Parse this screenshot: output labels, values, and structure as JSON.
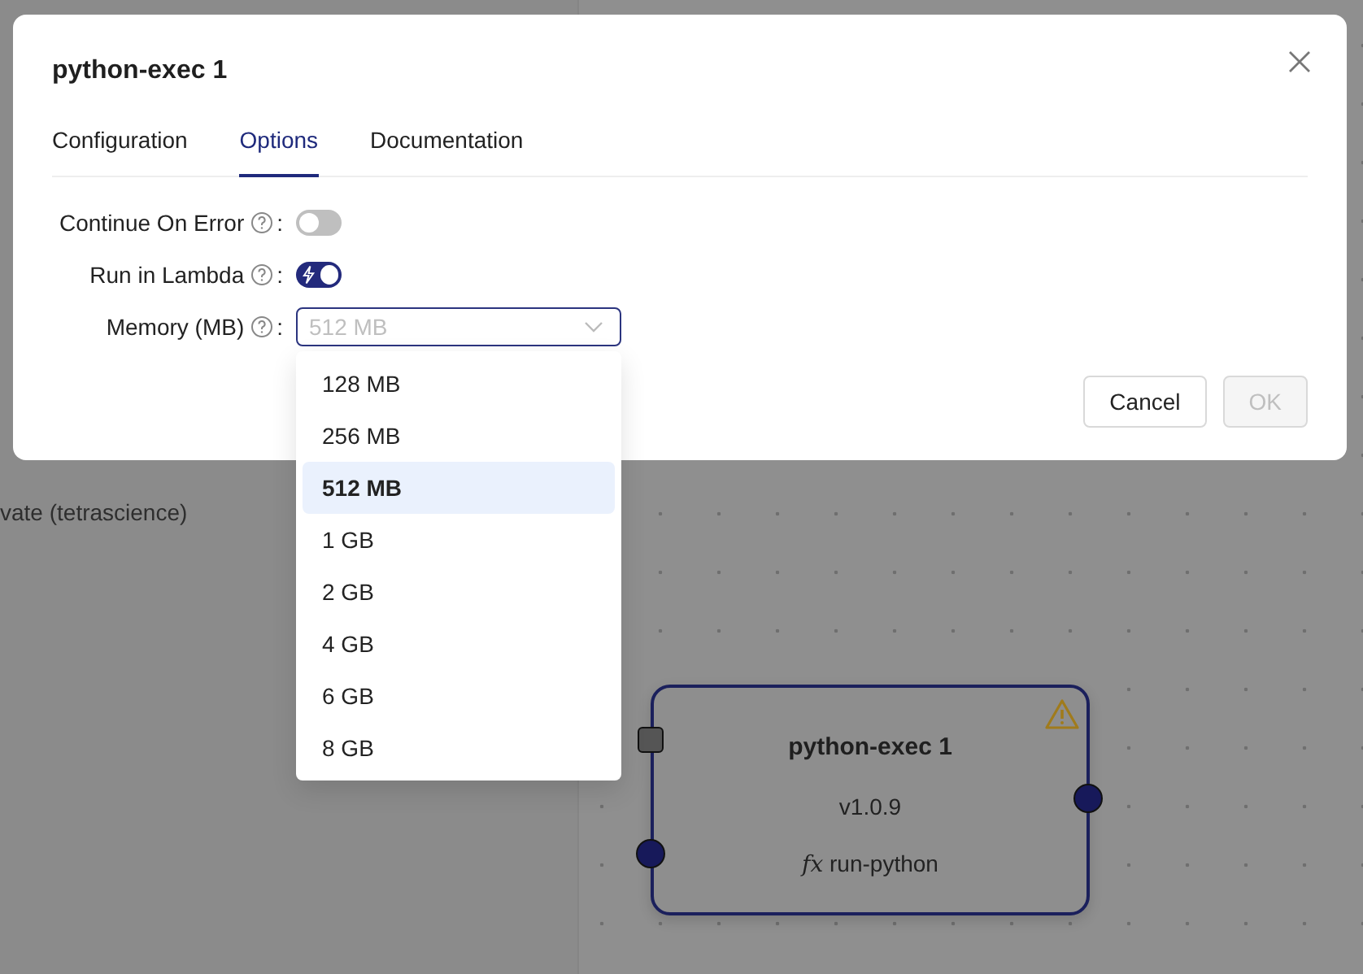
{
  "background_panel": {
    "fragments": [
      {
        "text": "vate (tetrascience)"
      }
    ]
  },
  "node": {
    "title": "python-exec 1",
    "version": "v1.0.9",
    "function_prefix": "fx",
    "function": "run-python",
    "warning": true
  },
  "modal": {
    "title": "python-exec 1",
    "tabs": [
      {
        "label": "Configuration",
        "selected": false
      },
      {
        "label": "Options",
        "selected": true
      },
      {
        "label": "Documentation",
        "selected": false
      }
    ],
    "fields": [
      {
        "kind": "switch",
        "label": "Continue On Error",
        "colon": ":",
        "on": false
      },
      {
        "kind": "switch",
        "label": "Run in Lambda",
        "colon": ":",
        "on": true
      },
      {
        "kind": "select",
        "label": "Memory (MB)",
        "colon": ":",
        "value": "512 MB",
        "expanded": true
      }
    ],
    "buttons": [
      {
        "label": "Cancel",
        "disabled": false
      },
      {
        "label": "OK",
        "disabled": true
      }
    ]
  },
  "dropdown": {
    "options": [
      {
        "label": "128 MB",
        "selected": false
      },
      {
        "label": "256 MB",
        "selected": false
      },
      {
        "label": "512 MB",
        "selected": true
      },
      {
        "label": "1 GB",
        "selected": false
      },
      {
        "label": "2 GB",
        "selected": false
      },
      {
        "label": "4 GB",
        "selected": false
      },
      {
        "label": "6 GB",
        "selected": false
      },
      {
        "label": "8 GB",
        "selected": false
      }
    ]
  }
}
